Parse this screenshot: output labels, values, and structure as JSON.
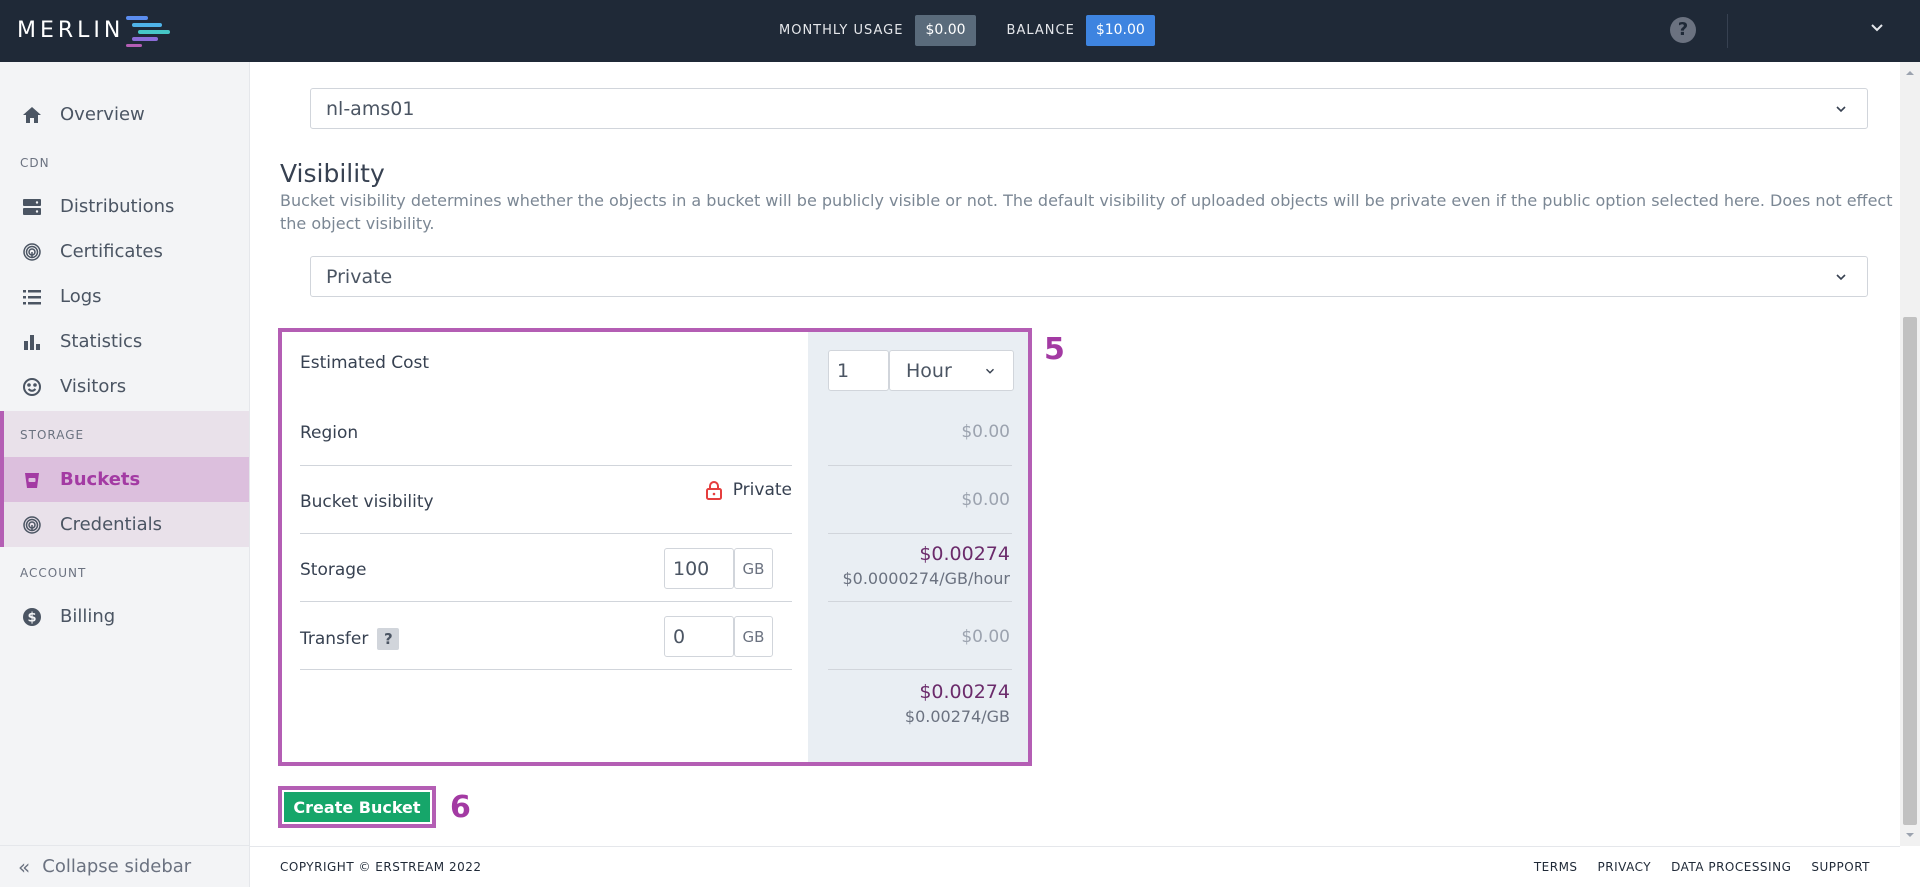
{
  "header": {
    "logo": "MERLIN",
    "monthly_usage_label": "MONTHLY USAGE",
    "monthly_usage_value": "$0.00",
    "balance_label": "BALANCE",
    "balance_value": "$10.00"
  },
  "sidebar": {
    "overview": "Overview",
    "cdn_label": "CDN",
    "distributions": "Distributions",
    "certificates": "Certificates",
    "logs": "Logs",
    "statistics": "Statistics",
    "visitors": "Visitors",
    "storage_label": "STORAGE",
    "buckets": "Buckets",
    "credentials": "Credentials",
    "account_label": "ACCOUNT",
    "billing": "Billing",
    "collapse": "Collapse sidebar"
  },
  "form": {
    "region_select_value": "nl-ams01",
    "visibility_title": "Visibility",
    "visibility_description": "Bucket visibility determines whether the objects in a bucket will be publicly visible or not. The default visibility of uploaded objects will be private even if the public option selected here. Does not effect the object visibility.",
    "visibility_select_value": "Private"
  },
  "estimate": {
    "title": "Estimated Cost",
    "duration_value": "1",
    "duration_unit": "Hour",
    "region_label": "Region",
    "region_cost": "$0.00",
    "bucket_visibility_label": "Bucket visibility",
    "bucket_visibility_value": "Private",
    "bucket_visibility_cost": "$0.00",
    "storage_label": "Storage",
    "storage_value": "100",
    "storage_unit": "GB",
    "storage_cost": "$0.00274",
    "storage_rate": "$0.0000274/GB/hour",
    "transfer_label": "Transfer",
    "transfer_help": "?",
    "transfer_value": "0",
    "transfer_unit": "GB",
    "transfer_cost": "$0.00",
    "total_cost": "$0.00274",
    "total_rate": "$0.00274/GB",
    "step_number": "5"
  },
  "actions": {
    "create_bucket": "Create Bucket",
    "step_number": "6"
  },
  "footer": {
    "copyright": "COPYRIGHT © ERSTREAM 2022",
    "terms": "TERMS",
    "privacy": "PRIVACY",
    "data_processing": "DATA PROCESSING",
    "support": "SUPPORT"
  },
  "colors": {
    "topbar": "#1f2937",
    "highlight": "#b45eb4",
    "accent_green": "#16a66a",
    "balance_blue": "#3e84e0"
  }
}
